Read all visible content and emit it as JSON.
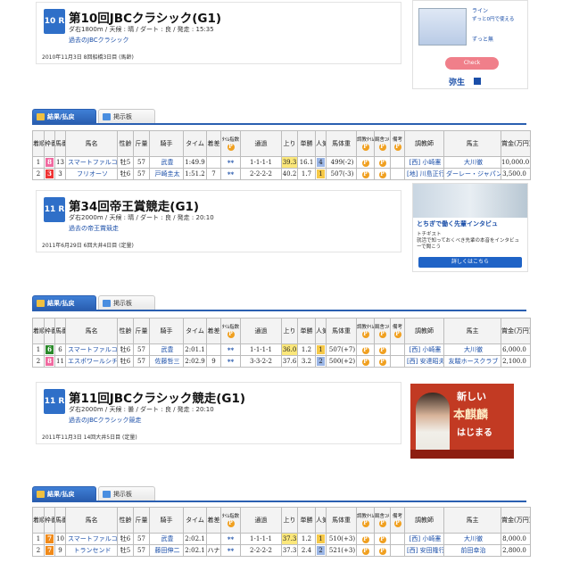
{
  "races": [
    {
      "num": "10 R",
      "title": "第10回JBCクラシック(G1)",
      "info": "ダ右1800m / 天候 : 晴 / ダート : 良 / 発走 : 15:35",
      "link": "過去のJBCクラシック",
      "date": "2010年11月3日  8回船橋3日目  (馬齢)"
    },
    {
      "num": "11 R",
      "title": "第34回帝王賞競走(G1)",
      "info": "ダ右2000m / 天候 : 晴 / ダート : 良 / 発走 : 20:10",
      "link": "過去の帝王賞競走",
      "date": "2011年6月29日  6回大井4日目  (定量)"
    },
    {
      "num": "11 R",
      "title": "第11回JBCクラシック競走(G1)",
      "info": "ダ右2000m / 天候 : 曇 / ダート : 良 / 発走 : 20:10",
      "link": "過去のJBCクラシック競走",
      "date": "2011年11月3日  14回大井5日目  (定量)"
    }
  ],
  "tabs": {
    "results": "結果/払戻",
    "board": "掲示板"
  },
  "headers": {
    "rank": "着順",
    "frame": "枠番",
    "horse_no": "馬番",
    "horse": "馬名",
    "sexage": "性齢",
    "weight": "斤量",
    "jockey": "騎手",
    "time": "タイム",
    "margin": "着差",
    "time_index": "ﾀｲﾑ指数",
    "passing": "通過",
    "last3f": "上り",
    "odds": "単勝",
    "popularity": "人気",
    "body_weight": "馬体重",
    "training_time": "調教ﾀｲﾑ",
    "stable_comment": "厩舎ｺﾒﾝﾄ",
    "remarks": "備考",
    "trainer": "調教師",
    "owner": "馬主",
    "prize": "賞金(万円)"
  },
  "tables": [
    [
      {
        "rank": "1",
        "frame": "8",
        "frame_color": "w8",
        "no": "13",
        "horse": "スマートファルコン",
        "sexage": "牡5",
        "weight": "57",
        "jockey": "武豊",
        "time": "1:49.9",
        "margin": "",
        "idx": "**",
        "pass": "1-1-1-1",
        "last3f": "39.3",
        "odds": "16.1",
        "pop": "4",
        "body": "499(-2)",
        "trainer": "[西] 小崎憲",
        "owner": "大川徹",
        "prize": "10,000.0"
      },
      {
        "rank": "2",
        "frame": "3",
        "frame_color": "w3",
        "no": "3",
        "horse": "フリオーソ",
        "sexage": "牡6",
        "weight": "57",
        "jockey": "戸崎圭太",
        "time": "1:51.2",
        "margin": "7",
        "idx": "**",
        "pass": "2-2-2-2",
        "last3f": "40.2",
        "odds": "1.7",
        "pop": "1",
        "body": "507(-3)",
        "trainer": "[地] 川島正行",
        "owner": "ダーレー・ジャパン・",
        "prize": "3,500.0"
      }
    ],
    [
      {
        "rank": "1",
        "frame": "6",
        "frame_color": "w6",
        "no": "6",
        "horse": "スマートファルコン",
        "sexage": "牡6",
        "weight": "57",
        "jockey": "武豊",
        "time": "2:01.1",
        "margin": "",
        "idx": "**",
        "pass": "1-1-1-1",
        "last3f": "36.0",
        "odds": "1.2",
        "pop": "1",
        "body": "507(+7)",
        "trainer": "[西] 小崎憲",
        "owner": "大川徹",
        "prize": "6,000.0"
      },
      {
        "rank": "2",
        "frame": "8",
        "frame_color": "w8",
        "no": "11",
        "horse": "エスポワールシチー",
        "sexage": "牡6",
        "weight": "57",
        "jockey": "佐藤哲三",
        "time": "2:02.9",
        "margin": "9",
        "idx": "**",
        "pass": "3-3-2-2",
        "last3f": "37.6",
        "odds": "3.2",
        "pop": "2",
        "body": "500(+2)",
        "trainer": "[西] 安達昭夫",
        "owner": "友駿ホースクラブ",
        "prize": "2,100.0"
      }
    ],
    [
      {
        "rank": "1",
        "frame": "7",
        "frame_color": "w7",
        "no": "10",
        "horse": "スマートファルコン",
        "sexage": "牡6",
        "weight": "57",
        "jockey": "武豊",
        "time": "2:02.1",
        "margin": "",
        "idx": "**",
        "pass": "1-1-1-1",
        "last3f": "37.3",
        "odds": "1.2",
        "pop": "1",
        "body": "510(+3)",
        "trainer": "[西] 小崎憲",
        "owner": "大川徹",
        "prize": "8,000.0"
      },
      {
        "rank": "2",
        "frame": "7",
        "frame_color": "w7",
        "no": "9",
        "horse": "トランセンド",
        "sexage": "牡5",
        "weight": "57",
        "jockey": "藤田伸二",
        "time": "2:02.1",
        "margin": "ハナ",
        "idx": "**",
        "pass": "2-2-2-2",
        "last3f": "37.3",
        "odds": "2.4",
        "pop": "2",
        "body": "521(+3)",
        "trainer": "[西] 安田隆行",
        "owner": "前田幸治",
        "prize": "2,800.0"
      }
    ]
  ],
  "ads": {
    "ad1": {
      "line1": "ライン",
      "line2": "ずっと0円で使える",
      "line3": "ずっと無",
      "cta": "Check",
      "brand": "弥生"
    },
    "ad2": {
      "headline": "とちぎで働く先輩インタビュ",
      "company": "トチギスト",
      "sub": "就活で知っておくべき先輩の本音をインタビューで聞こう",
      "cta": "詳しくはこちら"
    },
    "ad3": {
      "line1": "新しい",
      "line2": "本麒麟",
      "line3": "はじまる"
    }
  }
}
